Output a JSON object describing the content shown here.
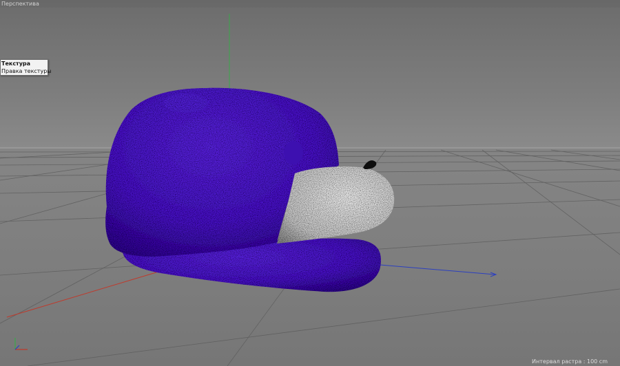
{
  "viewport": {
    "name": "Перспектива",
    "grid_info": "Интервал растра : 100 cm"
  },
  "context_menu": {
    "items": [
      {
        "label": "Текстура",
        "active": true
      },
      {
        "label": "Правка текстуры",
        "active": false
      }
    ]
  },
  "colors": {
    "model_body": "#4a17c9",
    "model_muzzle": "#d9d9d9",
    "grid_line": "#5c5c5c",
    "axis_x": "#c0392b",
    "axis_y": "#3aa84a",
    "axis_z": "#2b3fc0"
  },
  "icons": {
    "axis_gizmo": "axis-gizmo-icon"
  }
}
